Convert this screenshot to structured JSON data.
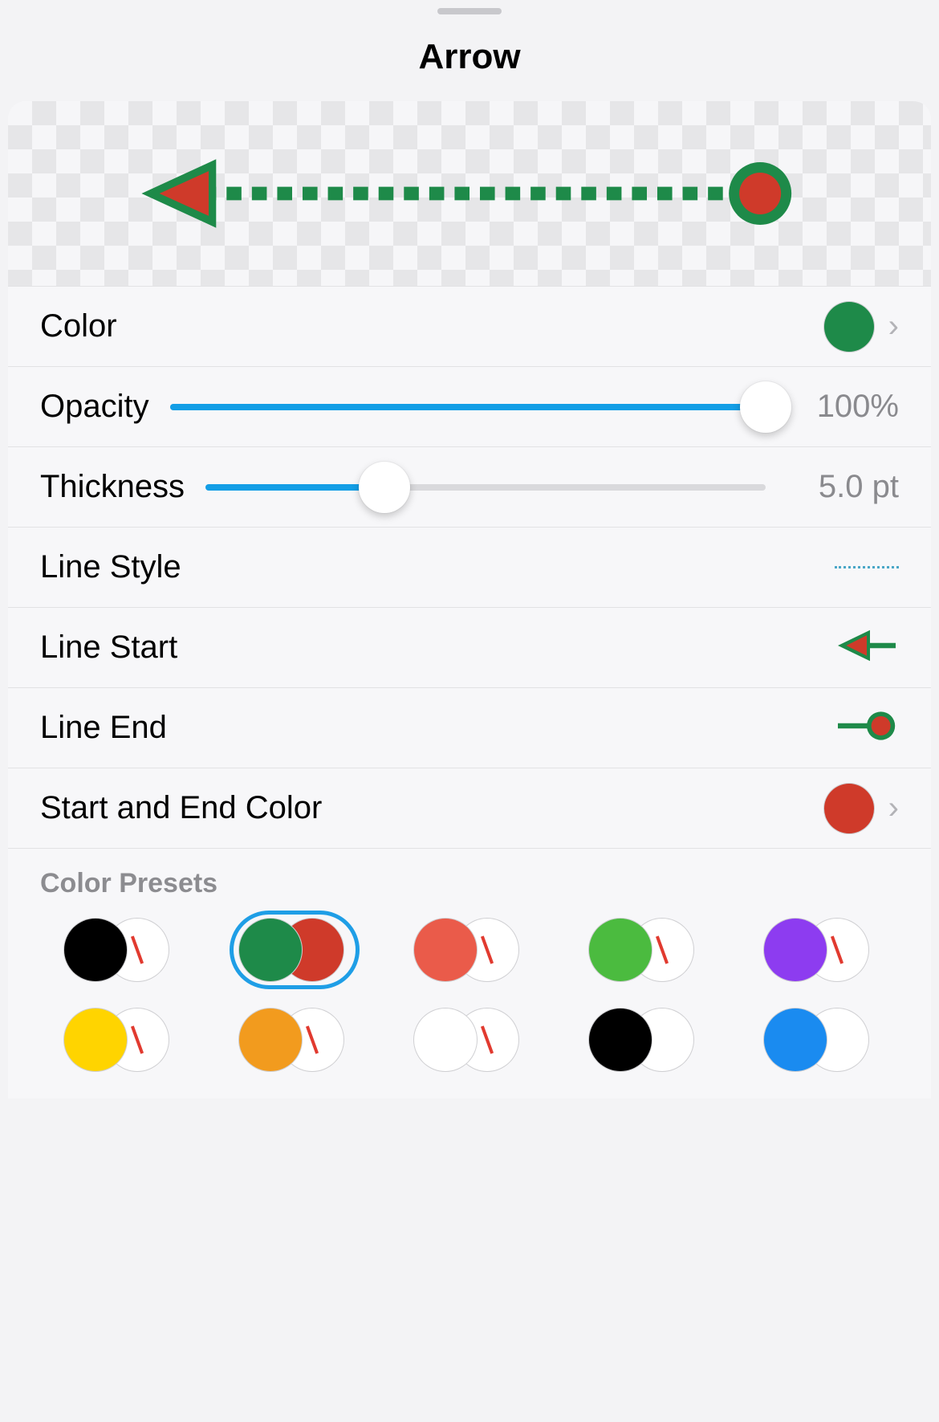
{
  "title": "Arrow",
  "colors": {
    "primary": "#1e8a49",
    "accentFill": "#cf3a2a",
    "slider": "#139ee6"
  },
  "rows": {
    "color": {
      "label": "Color",
      "value": "#1e8a49"
    },
    "opacity": {
      "label": "Opacity",
      "value_text": "100%",
      "percent": 100
    },
    "thickness": {
      "label": "Thickness",
      "value_text": "5.0 pt",
      "percent": 32
    },
    "line_style": {
      "label": "Line Style"
    },
    "line_start": {
      "label": "Line Start"
    },
    "line_end": {
      "label": "Line End"
    },
    "start_end_color": {
      "label": "Start and End Color",
      "value": "#cf3a2a"
    }
  },
  "presets": {
    "label": "Color Presets",
    "selected_index": 1,
    "items": [
      {
        "primary": "#000000",
        "secondary": "none"
      },
      {
        "primary": "#1e8a49",
        "secondary": "#cf3a2a"
      },
      {
        "primary": "#ea5b4a",
        "secondary": "none"
      },
      {
        "primary": "#4bbb3f",
        "secondary": "none"
      },
      {
        "primary": "#8d3cf0",
        "secondary": "none"
      },
      {
        "primary": "#ffd400",
        "secondary": "none"
      },
      {
        "primary": "#f29b1e",
        "secondary": "none"
      },
      {
        "primary": "#ffffff",
        "secondary": "none"
      },
      {
        "primary": "#000000",
        "secondary": "#ffffff"
      },
      {
        "primary": "#1a8bf0",
        "secondary": "#ffffff"
      }
    ]
  }
}
